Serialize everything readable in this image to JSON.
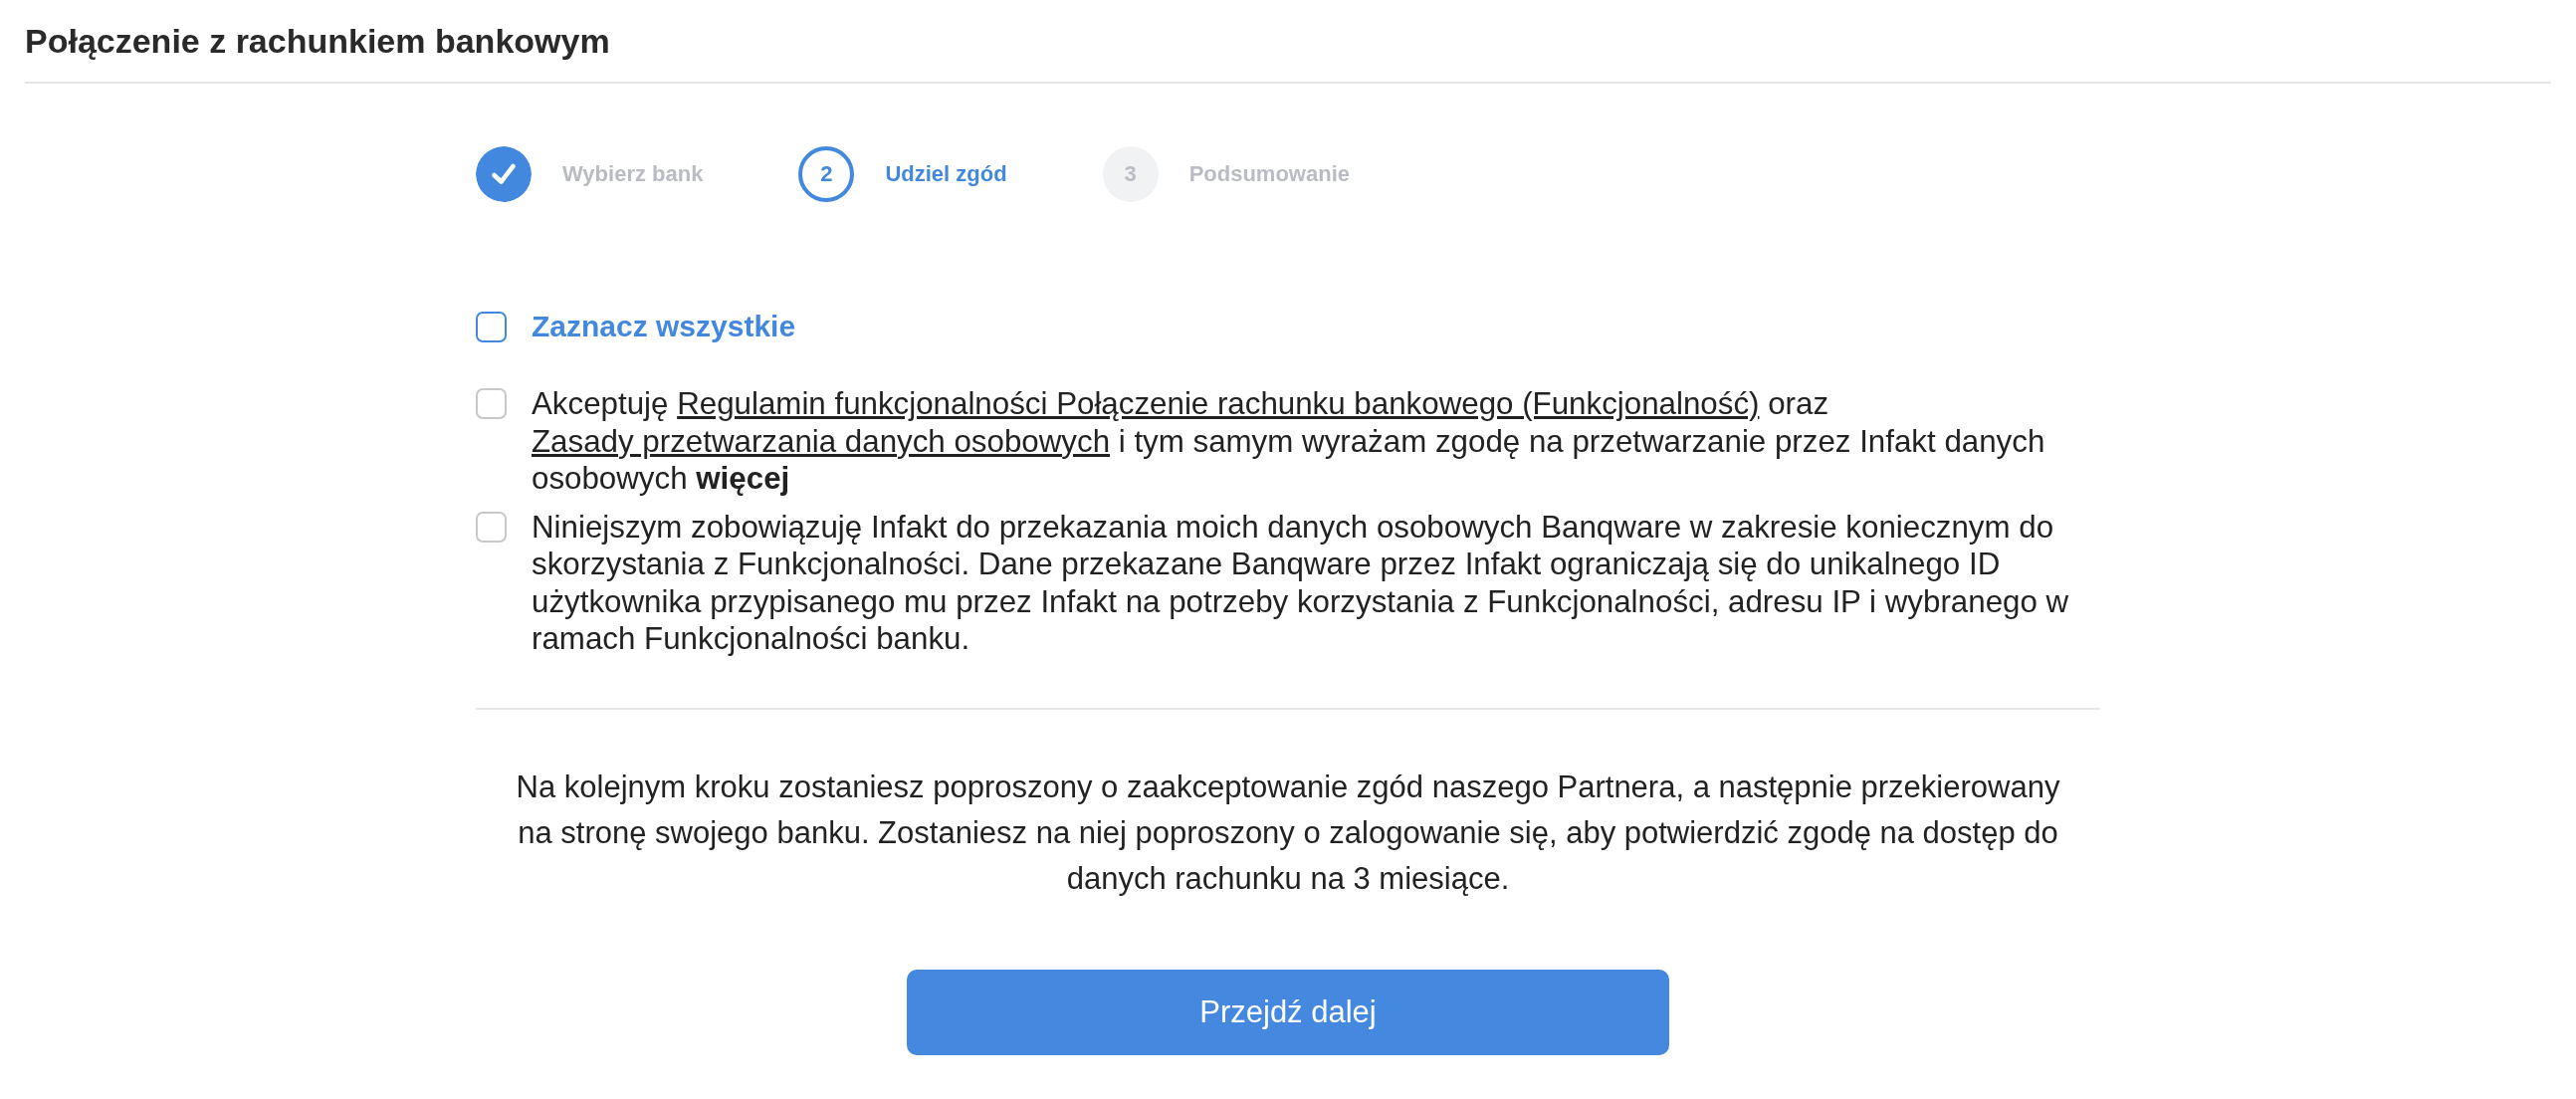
{
  "header": {
    "title": "Połączenie z rachunkiem bankowym"
  },
  "steps": [
    {
      "label": "Wybierz bank",
      "completed": true,
      "selected": false
    },
    {
      "number": "2",
      "label": "Udziel zgód",
      "completed": false,
      "selected": true
    },
    {
      "number": "3",
      "label": "Podsumowanie",
      "completed": false,
      "selected": false
    }
  ],
  "consents": {
    "select_all": {
      "label": "Zaznacz wszystkie",
      "checked": false
    },
    "items": [
      {
        "checked": false,
        "parts": [
          {
            "kind": "text",
            "text": "Akceptuję "
          },
          {
            "kind": "link",
            "text": "Regulamin funkcjonalności Połączenie rachunku bankowego (Funkcjonalność)"
          },
          {
            "kind": "text",
            "text": " oraz "
          },
          {
            "kind": "link",
            "text": "Zasady przetwarzania danych osobowych"
          },
          {
            "kind": "text",
            "text": " i tym samym wyrażam zgodę na przetwarzanie przez Infakt danych osobowych "
          },
          {
            "kind": "more",
            "text": "więcej"
          }
        ]
      },
      {
        "checked": false,
        "parts": [
          {
            "kind": "text",
            "text": "Niniejszym zobowiązuję Infakt do przekazania moich danych osobowych Banqware w zakresie koniecznym do skorzystania z Funkcjonalności. Dane przekazane Banqware przez Infakt ograniczają się do unikalnego ID użytkownika przypisanego mu przez Infakt na potrzeby korzystania z Funkcjonalności, adresu IP i wybranego w ramach Funkcjonalności banku."
          }
        ]
      }
    ]
  },
  "info": {
    "text": "Na kolejnym kroku zostaniesz poproszony o zaakceptowanie zgód naszego Partnera, a następnie przekierowany na stronę swojego banku. Zostaniesz na niej poproszony o zalogowanie się, aby potwierdzić zgodę na dostęp do danych rachunku na 3 miesiące."
  },
  "next_button": {
    "label": "Przejdź dalej"
  }
}
